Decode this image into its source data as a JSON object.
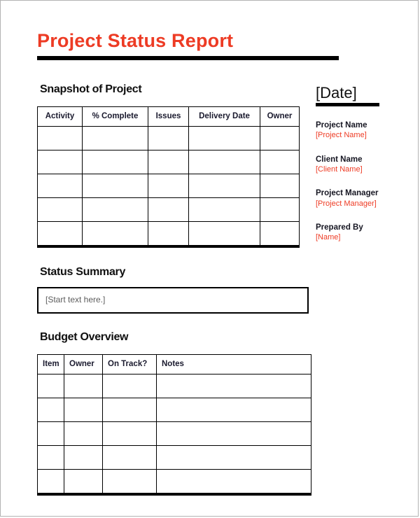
{
  "document": {
    "title": "Project Status Report",
    "accent_color": "#ed3b24",
    "rule_color": "#000000"
  },
  "sections": {
    "snapshot_heading": "Snapshot of Project",
    "status_heading": "Status Summary",
    "budget_heading": "Budget Overview"
  },
  "snapshot_table": {
    "columns": [
      "Activity",
      "% Complete",
      "Issues",
      "Delivery Date",
      "Owner"
    ],
    "rows": [
      [
        "",
        "",
        "",
        "",
        ""
      ],
      [
        "",
        "",
        "",
        "",
        ""
      ],
      [
        "",
        "",
        "",
        "",
        ""
      ],
      [
        "",
        "",
        "",
        "",
        ""
      ],
      [
        "",
        "",
        "",
        "",
        ""
      ]
    ]
  },
  "status_summary": {
    "placeholder": "[Start text here.]",
    "value": ""
  },
  "budget_table": {
    "columns": [
      "Item",
      "Owner",
      "On Track?",
      "Notes"
    ],
    "rows": [
      [
        "",
        "",
        "",
        ""
      ],
      [
        "",
        "",
        "",
        ""
      ],
      [
        "",
        "",
        "",
        ""
      ],
      [
        "",
        "",
        "",
        ""
      ],
      [
        "",
        "",
        "",
        ""
      ]
    ]
  },
  "sidebar": {
    "date": "[Date]",
    "fields": [
      {
        "label": "Project Name",
        "value": "[Project Name]"
      },
      {
        "label": "Client Name",
        "value": "[Client Name]"
      },
      {
        "label": "Project Manager",
        "value": "[Project Manager]"
      },
      {
        "label": "Prepared By",
        "value": "[Name]"
      }
    ]
  }
}
